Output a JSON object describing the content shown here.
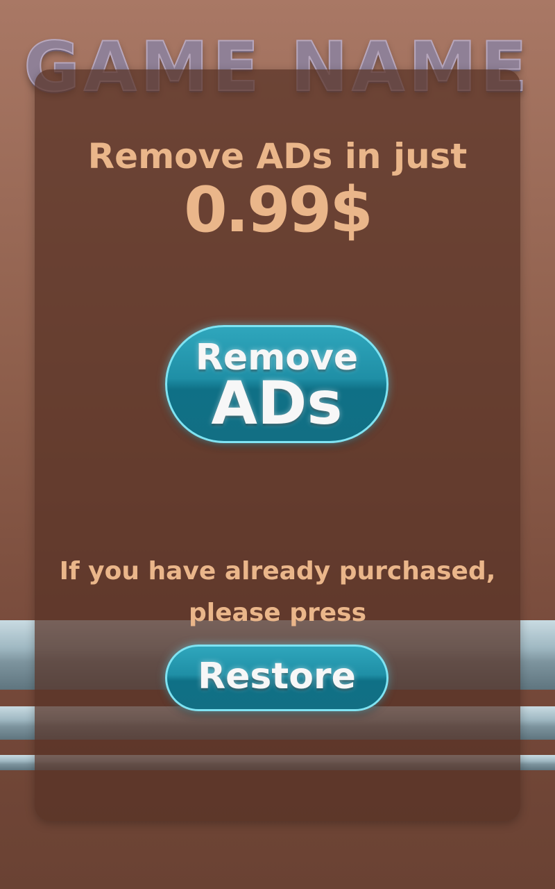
{
  "game": {
    "title": "GAME NAME"
  },
  "offer": {
    "headline": "Remove ADs in just",
    "price": "0.99$"
  },
  "buttons": {
    "remove_line1": "Remove",
    "remove_line2": "ADs",
    "restore": "Restore"
  },
  "restore_info": {
    "line1": "If you have already purchased,",
    "line2": "please press"
  },
  "colors": {
    "text_accent": "#eab68a",
    "button_teal": "#1f8fa6",
    "button_border": "#7fe3f2",
    "panel": "#583226"
  }
}
